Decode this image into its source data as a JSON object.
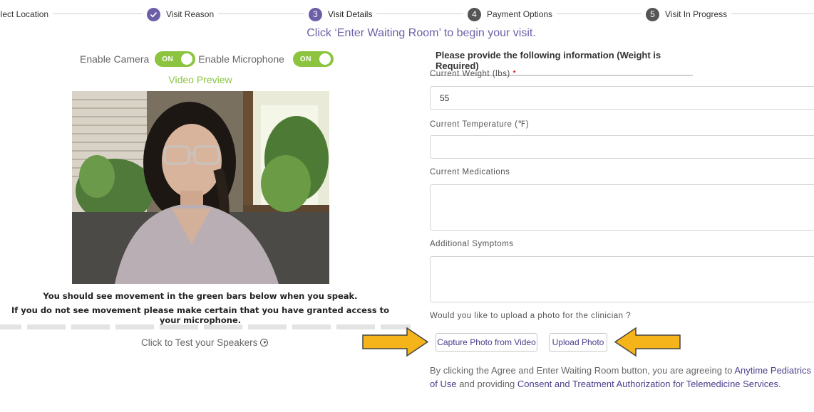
{
  "stepper": {
    "steps": [
      {
        "number": "",
        "label": "elect Location",
        "state": "done-hidden"
      },
      {
        "number": "✓",
        "label": "Visit Reason",
        "state": "done"
      },
      {
        "number": "3",
        "label": "Visit Details",
        "state": "active"
      },
      {
        "number": "4",
        "label": "Payment Options",
        "state": "future"
      },
      {
        "number": "5",
        "label": "Visit In Progress",
        "state": "future"
      }
    ]
  },
  "banner": "Click ‘Enter Waiting Room’ to begin your visit.",
  "media": {
    "camera_label": "Enable Camera",
    "camera_toggle": "ON",
    "mic_label": "Enable Microphone",
    "mic_toggle": "ON",
    "preview_title": "Video Preview",
    "mic_line1": "You should see movement in the green bars below when you speak.",
    "mic_line2": "If you do not see movement please make certain that you have granted access to your microphone.",
    "speaker_test": "Click to Test your Speakers"
  },
  "form": {
    "heading": "Please provide the following information (Weight is Required)",
    "weight_label": "Current Weight (lbs)",
    "required_mark": "*",
    "weight_value": "55",
    "temp_label": "Current Temperature (℉)",
    "temp_value": "",
    "meds_label": "Current Medications",
    "meds_value": "",
    "symptoms_label": "Additional Symptoms",
    "symptoms_value": "",
    "photo_question": "Would you like to upload a photo for the clinician ?",
    "capture_button": "Capture Photo from Video",
    "upload_button": "Upload Photo"
  },
  "agreement": {
    "prefix": "By clicking the Agree and Enter Waiting Room button, you are agreeing to ",
    "link1": "Anytime Pediatrics PF",
    "link1_cont": "of Use",
    "middle": " and providing ",
    "link2": "Consent and Treatment Authorization for Telemedicine Services",
    "suffix": "."
  },
  "colors": {
    "brand_purple": "#6c5fa7",
    "toggle_green": "#8cc43f",
    "arrow_yellow": "#f5b41a",
    "required_red": "#d0021b"
  },
  "icons": {
    "step_done": "checkmark-icon",
    "speaker_test": "play-circle-icon",
    "annotation": "arrow-icon"
  }
}
